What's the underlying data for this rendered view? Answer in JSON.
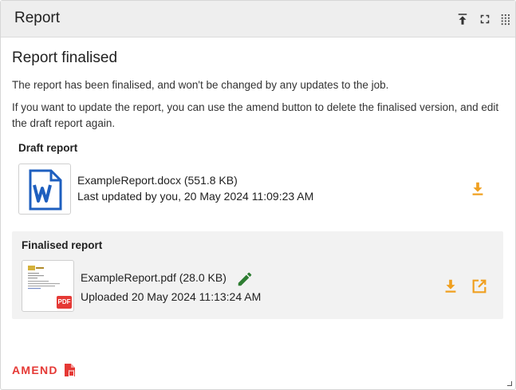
{
  "header": {
    "title": "Report",
    "icons": [
      "pin-top-icon",
      "fullscreen-icon",
      "drag-handle-icon"
    ]
  },
  "heading": "Report finalised",
  "paragraph_1": "The report has been finalised, and won't be changed by any updates to the job.",
  "paragraph_2": "If you want to update the report, you can use the amend button to delete the finalised version, and edit the draft report again.",
  "draft": {
    "label": "Draft report",
    "file_name": "ExampleReport.docx (551.8 KB)",
    "meta": "Last updated by you, 20 May 2024 11:09:23 AM",
    "thumb_icon": "word-document-icon",
    "actions": [
      "download-icon"
    ]
  },
  "final": {
    "label": "Finalised report",
    "file_name": "ExampleReport.pdf (28.0 KB)",
    "meta": "Uploaded 20 May 2024 11:13:24 AM",
    "thumb_badge": "PDF",
    "actions": [
      "edit-icon",
      "download-icon",
      "open-external-icon"
    ]
  },
  "amend": {
    "label": "AMEND",
    "icon": "file-delete-icon"
  },
  "colors": {
    "accent_orange": "#f0a020",
    "edit_green": "#2e7d32",
    "amend_red": "#e53935",
    "word_blue": "#1e5fbf",
    "pdf_red": "#e53935"
  }
}
